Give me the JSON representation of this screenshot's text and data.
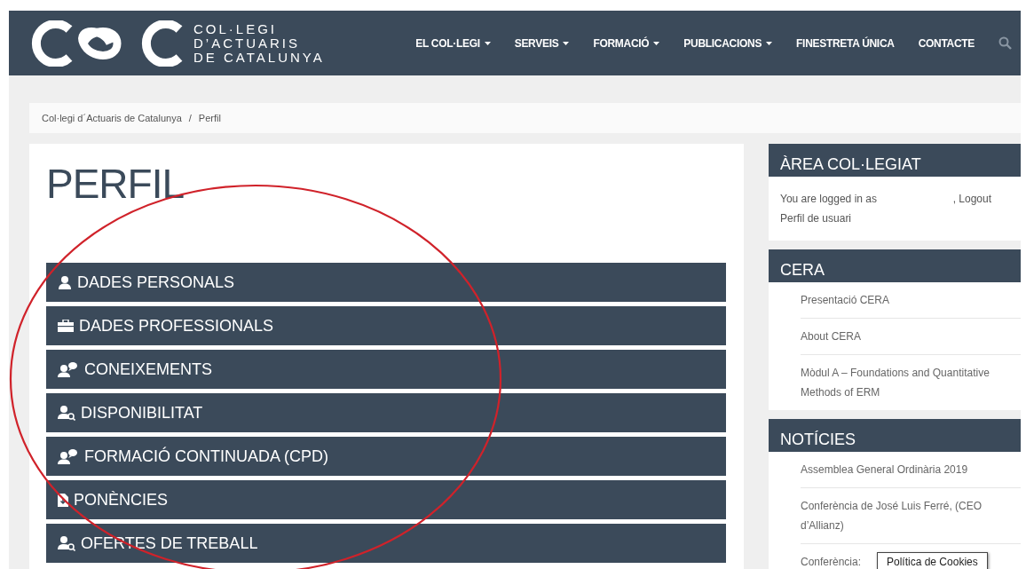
{
  "header": {
    "logo_lines": [
      "COL·LEGI",
      "D’ACTUARIS",
      "DE CATALUNYA"
    ],
    "nav": [
      {
        "label": "EL COL·LEGI",
        "dropdown": true
      },
      {
        "label": "SERVEIS",
        "dropdown": true
      },
      {
        "label": "FORMACIÓ",
        "dropdown": true
      },
      {
        "label": "PUBLICACIONS",
        "dropdown": true
      },
      {
        "label": "FINESTRETA ÚNICA",
        "dropdown": false
      },
      {
        "label": "CONTACTE",
        "dropdown": false
      }
    ]
  },
  "breadcrumb": [
    "Col·legi d´Actuaris de Catalunya",
    "Perfil"
  ],
  "breadcrumb_separator": "/",
  "page_title": "PERFIL",
  "profile_sections": [
    {
      "label": "DADES PERSONALS",
      "kind": "user"
    },
    {
      "label": "DADES PROFESSIONALS",
      "kind": "briefcase"
    },
    {
      "label": "CONEIXEMENTS",
      "kind": "userchat"
    },
    {
      "label": "DISPONIBILITAT",
      "kind": "usersearch"
    },
    {
      "label": "FORMACIÓ CONTINUADA (CPD)",
      "kind": "userchat"
    },
    {
      "label": "PONÈNCIES",
      "kind": "file"
    },
    {
      "label": "OFERTES DE TREBALL",
      "kind": "usersearch"
    }
  ],
  "sidebar": {
    "account": {
      "title": "ÀREA COL·LEGIAT",
      "logged_in_text": "You are logged in as",
      "logout": ", Logout",
      "profile_link": "Perfil de usuari"
    },
    "widgets": [
      {
        "title": "CERA",
        "links": [
          "Presentació CERA",
          "About CERA",
          "Mòdul A – Foundations and Quantitative Methods of ERM"
        ]
      },
      {
        "title": "NOTÍCIES",
        "links": [
          "Assemblea General Ordinària 2019",
          "Conferència de José Luis Ferré, (CEO d’Allianz)",
          "Conferència:"
        ]
      }
    ]
  },
  "cookie_popup": {
    "label": "Política de Cookies"
  }
}
